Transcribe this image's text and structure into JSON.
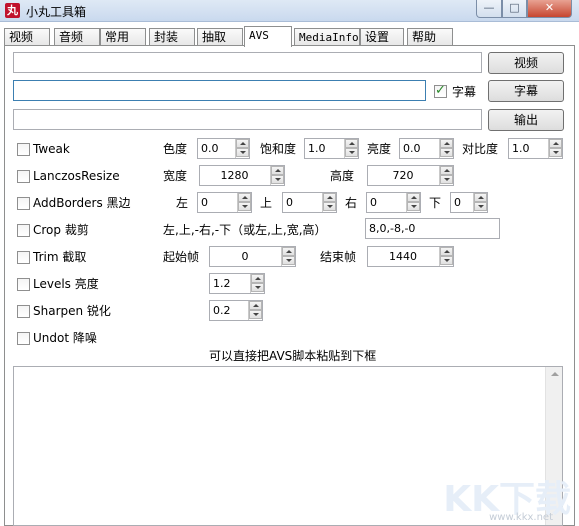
{
  "window": {
    "title": "小丸工具箱"
  },
  "tabs": [
    {
      "label": "视频"
    },
    {
      "label": "音频"
    },
    {
      "label": "常用"
    },
    {
      "label": "封装"
    },
    {
      "label": "抽取"
    },
    {
      "label": "AVS"
    },
    {
      "label": "MediaInfo"
    },
    {
      "label": "设置"
    },
    {
      "label": "帮助"
    }
  ],
  "active_tab": "AVS",
  "io": {
    "video_path": {
      "value": ""
    },
    "subtitle_path": {
      "value": ""
    },
    "output_path": {
      "value": ""
    },
    "subtitle_checkbox_label": "字幕",
    "subtitle_checked": true,
    "video_button": "视频",
    "subtitle_button": "字幕",
    "output_button": "输出"
  },
  "filters": {
    "tweak": {
      "label": "Tweak",
      "hue_label": "色度",
      "hue": "0.0",
      "sat_label": "饱和度",
      "sat": "1.0",
      "bright_label": "亮度",
      "bright": "0.0",
      "cont_label": "对比度",
      "cont": "1.0"
    },
    "resize": {
      "label": "LanczosResize",
      "width_label": "宽度",
      "width": "1280",
      "height_label": "高度",
      "height": "720"
    },
    "borders": {
      "label": "AddBorders 黑边",
      "left_label": "左",
      "left": "0",
      "top_label": "上",
      "top": "0",
      "right_label": "右",
      "right": "0",
      "bottom_label": "下",
      "bottom": "0"
    },
    "crop": {
      "label": "Crop 裁剪",
      "hint": "左,上,-右,-下（或左,上,宽,高）",
      "value": "8,0,-8,-0"
    },
    "trim": {
      "label": "Trim 截取",
      "start_label": "起始帧",
      "start": "0",
      "end_label": "结束帧",
      "end": "1440"
    },
    "levels": {
      "label": "Levels 亮度",
      "value": "1.2"
    },
    "sharpen": {
      "label": "Sharpen 锐化",
      "value": "0.2"
    },
    "undot": {
      "label": "Undot 降噪"
    }
  },
  "script_area": {
    "caption": "可以直接把AVS脚本粘贴到下框",
    "content": ""
  },
  "watermark": {
    "text": "KK下载",
    "url": "www.kkx.net"
  }
}
